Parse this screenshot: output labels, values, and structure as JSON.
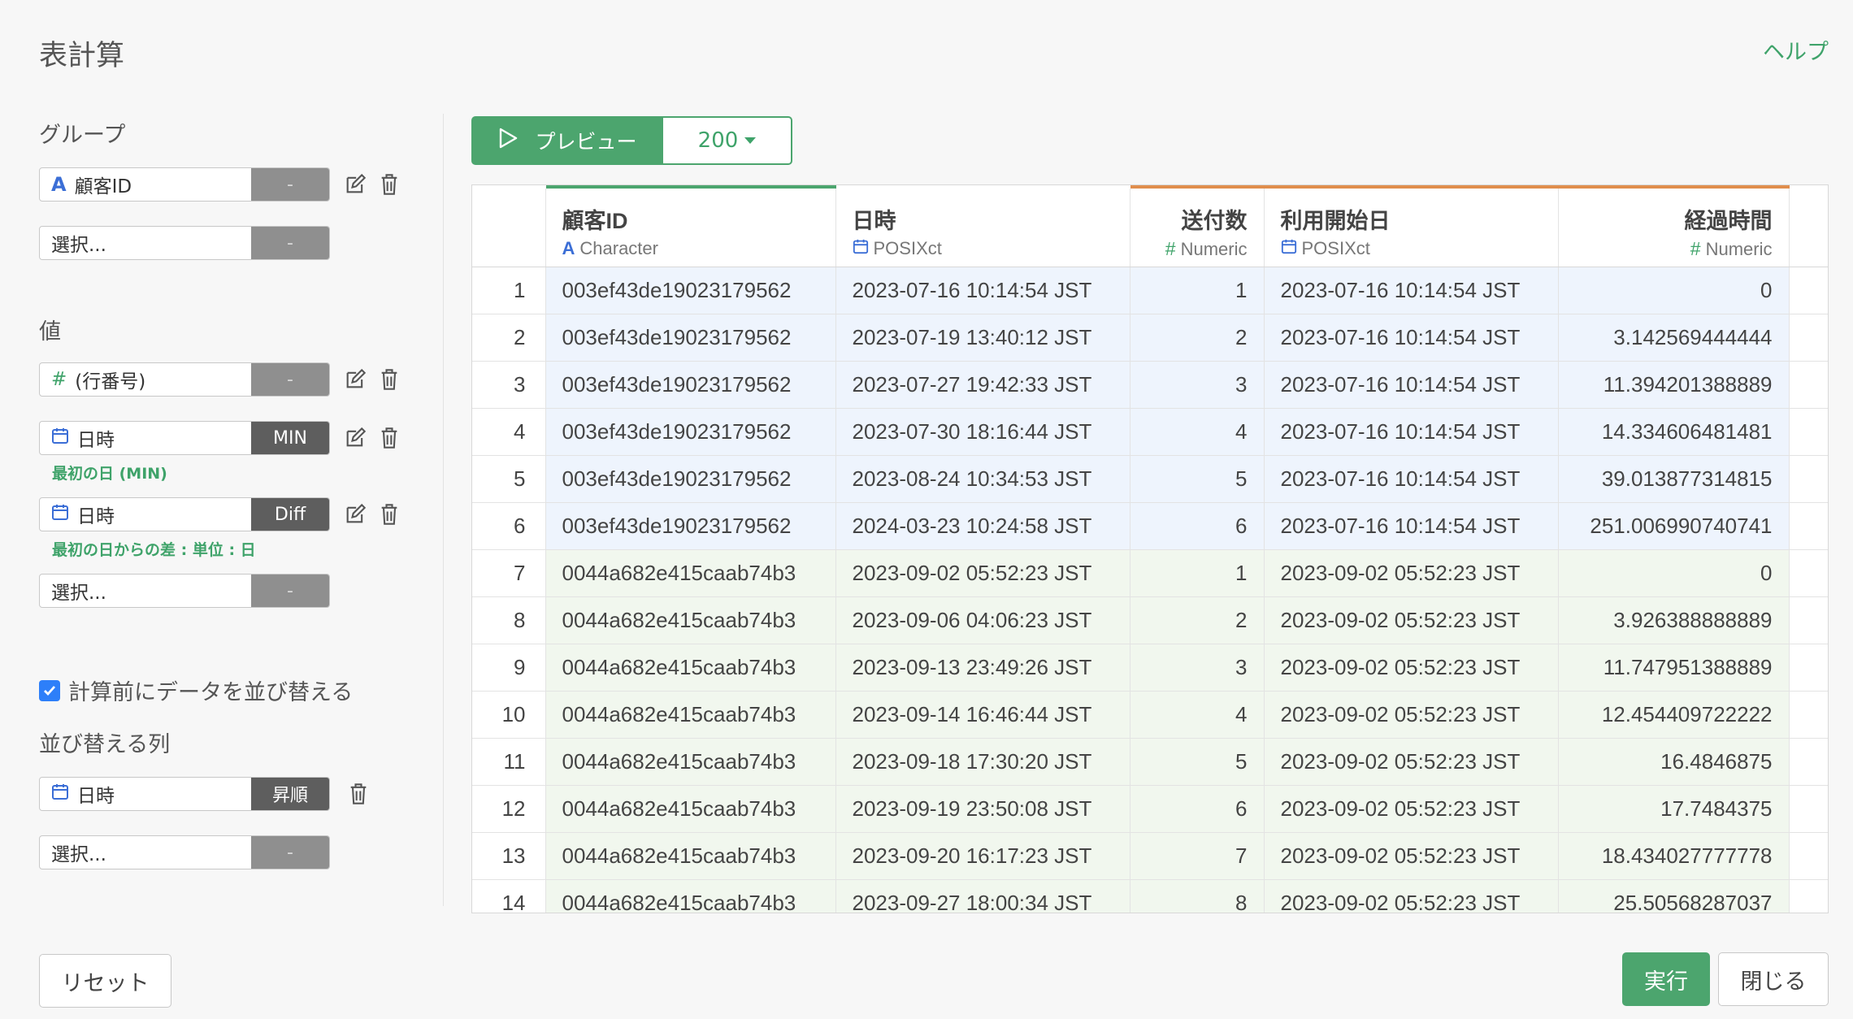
{
  "header": {
    "title": "表計算",
    "help": "ヘルプ"
  },
  "left": {
    "group_label": "グループ",
    "group_field": {
      "name": "顧客ID",
      "agg": "-"
    },
    "group_select": {
      "placeholder": "選択...",
      "agg": "-"
    },
    "value_label": "値",
    "values": [
      {
        "name": "(行番号)",
        "agg": "-",
        "note": ""
      },
      {
        "name": "日時",
        "agg": "MIN",
        "note": "最初の日 (MIN)"
      },
      {
        "name": "日時",
        "agg": "Diff",
        "note": "最初の日からの差 : 単位 : 日"
      }
    ],
    "value_select": {
      "placeholder": "選択...",
      "agg": "-"
    },
    "sort_checkbox": {
      "label": "計算前にデータを並び替える",
      "checked": true
    },
    "sort_label": "並び替える列",
    "sort_field": {
      "name": "日時",
      "order": "昇順"
    },
    "sort_select": {
      "placeholder": "選択...",
      "agg": "-"
    }
  },
  "toolbar": {
    "preview": "プレビュー",
    "rows": "200"
  },
  "table": {
    "columns": [
      {
        "name": "顧客ID",
        "type": "Character"
      },
      {
        "name": "日時",
        "type": "POSIXct"
      },
      {
        "name": "送付数",
        "type": "Numeric"
      },
      {
        "name": "利用開始日",
        "type": "POSIXct"
      },
      {
        "name": "経過時間",
        "type": "Numeric"
      }
    ],
    "rows": [
      [
        "1",
        "003ef43de19023179562",
        "2023-07-16 10:14:54 JST",
        "1",
        "2023-07-16 10:14:54 JST",
        "0"
      ],
      [
        "2",
        "003ef43de19023179562",
        "2023-07-19 13:40:12 JST",
        "2",
        "2023-07-16 10:14:54 JST",
        "3.142569444444"
      ],
      [
        "3",
        "003ef43de19023179562",
        "2023-07-27 19:42:33 JST",
        "3",
        "2023-07-16 10:14:54 JST",
        "11.394201388889"
      ],
      [
        "4",
        "003ef43de19023179562",
        "2023-07-30 18:16:44 JST",
        "4",
        "2023-07-16 10:14:54 JST",
        "14.334606481481"
      ],
      [
        "5",
        "003ef43de19023179562",
        "2023-08-24 10:34:53 JST",
        "5",
        "2023-07-16 10:14:54 JST",
        "39.013877314815"
      ],
      [
        "6",
        "003ef43de19023179562",
        "2024-03-23 10:24:58 JST",
        "6",
        "2023-07-16 10:14:54 JST",
        "251.006990740741"
      ],
      [
        "7",
        "0044a682e415caab74b3",
        "2023-09-02 05:52:23 JST",
        "1",
        "2023-09-02 05:52:23 JST",
        "0"
      ],
      [
        "8",
        "0044a682e415caab74b3",
        "2023-09-06 04:06:23 JST",
        "2",
        "2023-09-02 05:52:23 JST",
        "3.926388888889"
      ],
      [
        "9",
        "0044a682e415caab74b3",
        "2023-09-13 23:49:26 JST",
        "3",
        "2023-09-02 05:52:23 JST",
        "11.747951388889"
      ],
      [
        "10",
        "0044a682e415caab74b3",
        "2023-09-14 16:46:44 JST",
        "4",
        "2023-09-02 05:52:23 JST",
        "12.454409722222"
      ],
      [
        "11",
        "0044a682e415caab74b3",
        "2023-09-18 17:30:20 JST",
        "5",
        "2023-09-02 05:52:23 JST",
        "16.4846875"
      ],
      [
        "12",
        "0044a682e415caab74b3",
        "2023-09-19 23:50:08 JST",
        "6",
        "2023-09-02 05:52:23 JST",
        "17.7484375"
      ],
      [
        "13",
        "0044a682e415caab74b3",
        "2023-09-20 16:17:23 JST",
        "7",
        "2023-09-02 05:52:23 JST",
        "18.434027777778"
      ],
      [
        "14",
        "0044a682e415caab74b3",
        "2023-09-27 18:00:34 JST",
        "8",
        "2023-09-02 05:52:23 JST",
        "25.50568287037"
      ]
    ]
  },
  "footer": {
    "reset": "リセット",
    "run": "実行",
    "close": "閉じる"
  },
  "colors": {
    "accent": "#4ca56e",
    "group1_row": "#eef4fd",
    "group2_row": "#f1f7ee",
    "orange": "#e08e4d"
  }
}
